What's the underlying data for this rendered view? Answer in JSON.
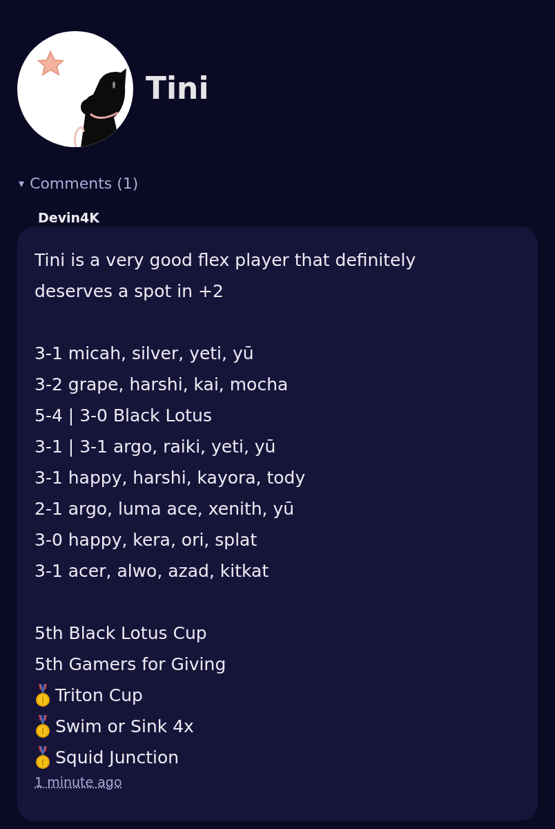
{
  "profile": {
    "name": "Tini"
  },
  "comments": {
    "toggle": "▾",
    "label": "Comments (1)",
    "expanded": true,
    "items": [
      {
        "author": "Devin4K",
        "time": "1 minute ago",
        "paragraphs": [
          [
            {
              "kind": "plain",
              "text": "Tini is a very good flex player that definitely deserves a spot in +2"
            }
          ],
          [
            {
              "kind": "plain",
              "text": "3-1 micah, silver, yeti, yū"
            },
            {
              "kind": "plain",
              "text": "3-2 grape, harshi, kai, mocha"
            },
            {
              "kind": "plain",
              "text": "5-4 | 3-0 Black Lotus"
            },
            {
              "kind": "plain",
              "text": "3-1 | 3-1 argo, raiki, yeti, yū"
            },
            {
              "kind": "plain",
              "text": "3-1 happy, harshi, kayora, tody"
            },
            {
              "kind": "plain",
              "text": "2-1 argo, luma ace, xenith, yū"
            },
            {
              "kind": "plain",
              "text": "3-0 happy, kera, ori, splat"
            },
            {
              "kind": "plain",
              "text": "3-1 acer, alwo, azad, kitkat"
            }
          ],
          [
            {
              "kind": "plain",
              "text": "5th Black Lotus Cup"
            },
            {
              "kind": "plain",
              "text": "5th Gamers for Giving"
            },
            {
              "kind": "medal",
              "text": "Triton Cup"
            },
            {
              "kind": "medal",
              "text": "Swim or Sink 4x"
            },
            {
              "kind": "medal",
              "text": "Squid Junction"
            }
          ]
        ]
      }
    ]
  }
}
